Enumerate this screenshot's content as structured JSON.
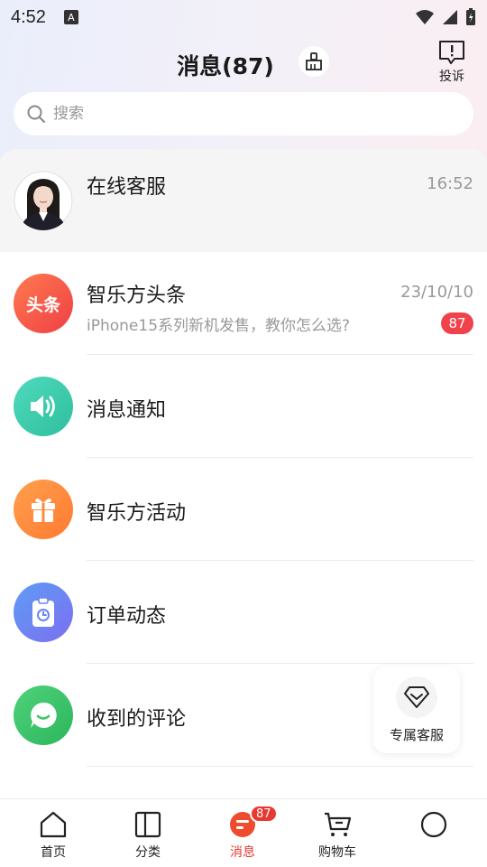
{
  "status_bar": {
    "time": "4:52",
    "notif_letter": "A"
  },
  "header": {
    "title": "消息(87)",
    "complaint_label": "投诉"
  },
  "search": {
    "placeholder": "搜索"
  },
  "pinned": {
    "title": "在线客服",
    "time": "16:52"
  },
  "rows": [
    {
      "title": "智乐方头条",
      "time": "23/10/10",
      "subtitle": "iPhone15系列新机发售，教你怎么选?",
      "badge": "87",
      "icon_text": "头条",
      "icon": "headline-icon"
    },
    {
      "title": "消息通知",
      "icon": "speaker-icon"
    },
    {
      "title": "智乐方活动",
      "icon": "gift-icon"
    },
    {
      "title": "订单动态",
      "icon": "clipboard-clock-icon"
    },
    {
      "title": "收到的评论",
      "icon": "chat-bubble-icon"
    }
  ],
  "float_service": {
    "label": "专属客服",
    "icon": "diamond-icon"
  },
  "tabbar": {
    "tabs": [
      {
        "label": "首页",
        "icon": "home-icon"
      },
      {
        "label": "分类",
        "icon": "category-icon"
      },
      {
        "label": "消息",
        "icon": "message-icon",
        "badge": "87"
      },
      {
        "label": "购物车",
        "icon": "cart-icon"
      },
      {
        "label": "",
        "icon": "profile-circle-icon"
      }
    ]
  },
  "colors": {
    "accent": "#e8382f",
    "badge": "#f0424b",
    "headline": "#f0504a",
    "notice": "#3dc8ab",
    "activity": "#ff8a3d",
    "order": "#6a86f2",
    "comment": "#3fc769"
  }
}
